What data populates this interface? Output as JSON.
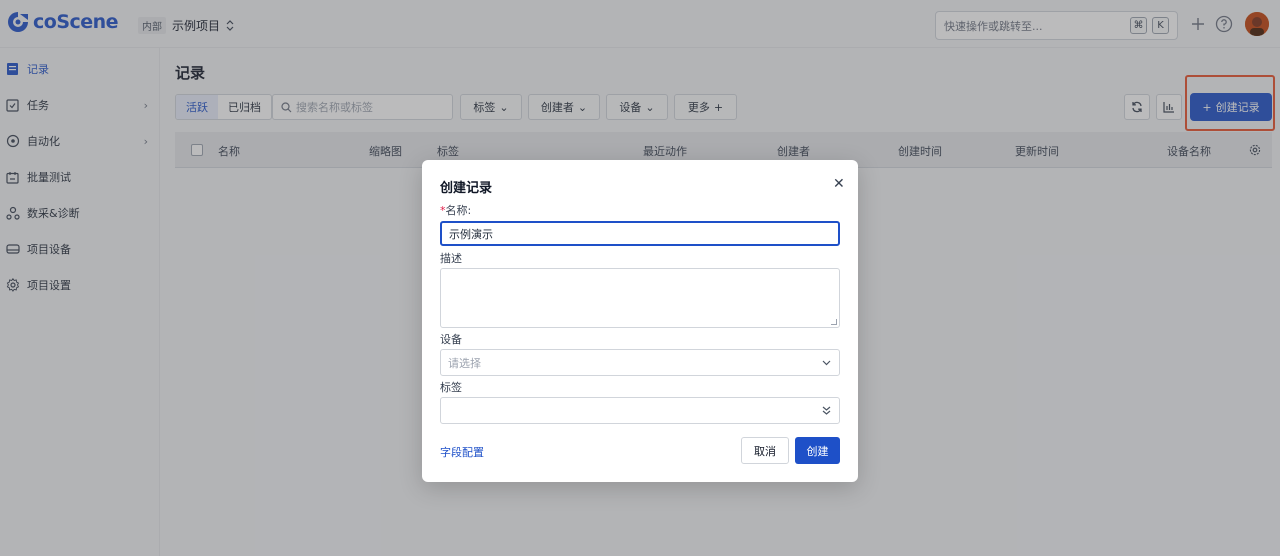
{
  "app": {
    "logo_text": "coScene",
    "org_badge": "内部",
    "project_name": "示例项目",
    "search_placeholder": "快速操作或跳转至...",
    "kbd_cmd": "⌘",
    "kbd_k": "K",
    "accent_color": "#1e50c8"
  },
  "sidebar": {
    "items": [
      {
        "label": "记录",
        "icon": "records-icon",
        "active": true
      },
      {
        "label": "任务",
        "icon": "tasks-icon",
        "has_children": true
      },
      {
        "label": "自动化",
        "icon": "automation-icon",
        "has_children": true
      },
      {
        "label": "批量测试",
        "icon": "batch-test-icon"
      },
      {
        "label": "数采&诊断",
        "icon": "diagnosis-icon"
      },
      {
        "label": "项目设备",
        "icon": "device-icon"
      },
      {
        "label": "项目设置",
        "icon": "settings-icon"
      }
    ]
  },
  "main": {
    "title": "记录",
    "tabs": [
      "活跃",
      "已归档"
    ],
    "active_tab": "活跃",
    "search_placeholder": "搜索名称或标签",
    "filters": [
      "标签",
      "创建者",
      "设备",
      "更多"
    ],
    "create_button": "创建记录",
    "columns": [
      "名称",
      "缩略图",
      "标签",
      "最近动作",
      "创建者",
      "创建时间",
      "更新时间",
      "设备名称"
    ]
  },
  "modal": {
    "title": "创建记录",
    "name_label": "名称:",
    "name_value": "示例演示",
    "description_label": "描述",
    "device_label": "设备",
    "device_placeholder": "请选择",
    "tags_label": "标签",
    "field_config_link": "字段配置",
    "cancel_label": "取消",
    "submit_label": "创建"
  }
}
